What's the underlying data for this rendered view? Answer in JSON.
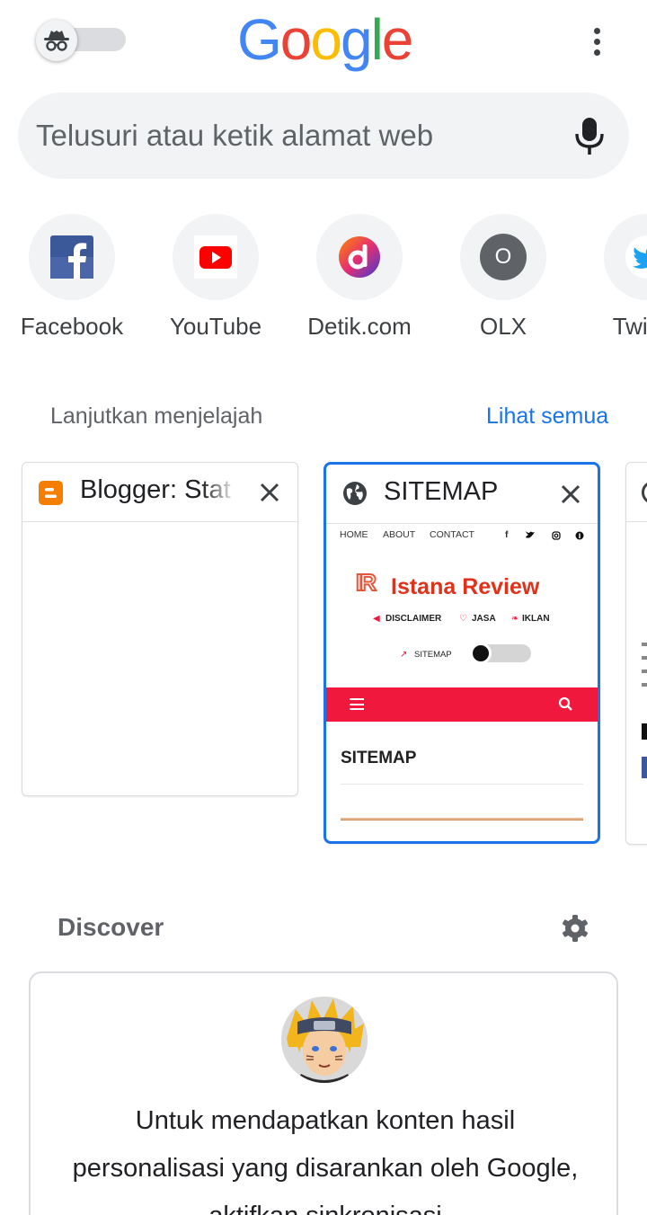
{
  "header": {
    "logo_letters": [
      {
        "ch": "G",
        "color": "#4285F4"
      },
      {
        "ch": "o",
        "color": "#EA4335"
      },
      {
        "ch": "o",
        "color": "#FBBC05"
      },
      {
        "ch": "g",
        "color": "#4285F4"
      },
      {
        "ch": "l",
        "color": "#34A853"
      },
      {
        "ch": "e",
        "color": "#EA4335"
      }
    ],
    "incognito_icon": "incognito-icon",
    "menu_icon": "more-vert-icon"
  },
  "search": {
    "placeholder": "Telusuri atau ketik alamat web",
    "mic_icon": "mic-icon"
  },
  "shortcuts": [
    {
      "label": "Facebook",
      "icon": "facebook-icon"
    },
    {
      "label": "YouTube",
      "icon": "youtube-icon"
    },
    {
      "label": "Detik.com",
      "icon": "detik-icon"
    },
    {
      "label": "OLX",
      "icon": "olx-icon",
      "letter": "O"
    },
    {
      "label": "Twitter",
      "icon": "twitter-icon"
    }
  ],
  "continue": {
    "label": "Lanjutkan menjelajah",
    "see_all": "Lihat semua",
    "tabs": [
      {
        "title": "Blogger: Stat",
        "icon": "blogger-icon",
        "selected": false
      },
      {
        "title": "SITEMAP",
        "icon": "globe-icon",
        "selected": true,
        "preview": {
          "nav": [
            "HOME",
            "ABOUT",
            "CONTACT"
          ],
          "brand_mark": "IR",
          "brand": "Istana Review",
          "links": [
            "DISCLAIMER",
            "JASA",
            "IKLAN"
          ],
          "sitemap_link": "SITEMAP",
          "heading": "SITEMAP",
          "accent": "#f1183d"
        }
      }
    ]
  },
  "discover": {
    "label": "Discover",
    "settings_icon": "gear-icon",
    "message": "Untuk mendapatkan konten hasil personalisasi yang disarankan oleh Google, aktifkan sinkronisasi"
  },
  "colors": {
    "accent": "#1a73e8",
    "surface": "#f1f3f4",
    "text_secondary": "#5f6368"
  }
}
